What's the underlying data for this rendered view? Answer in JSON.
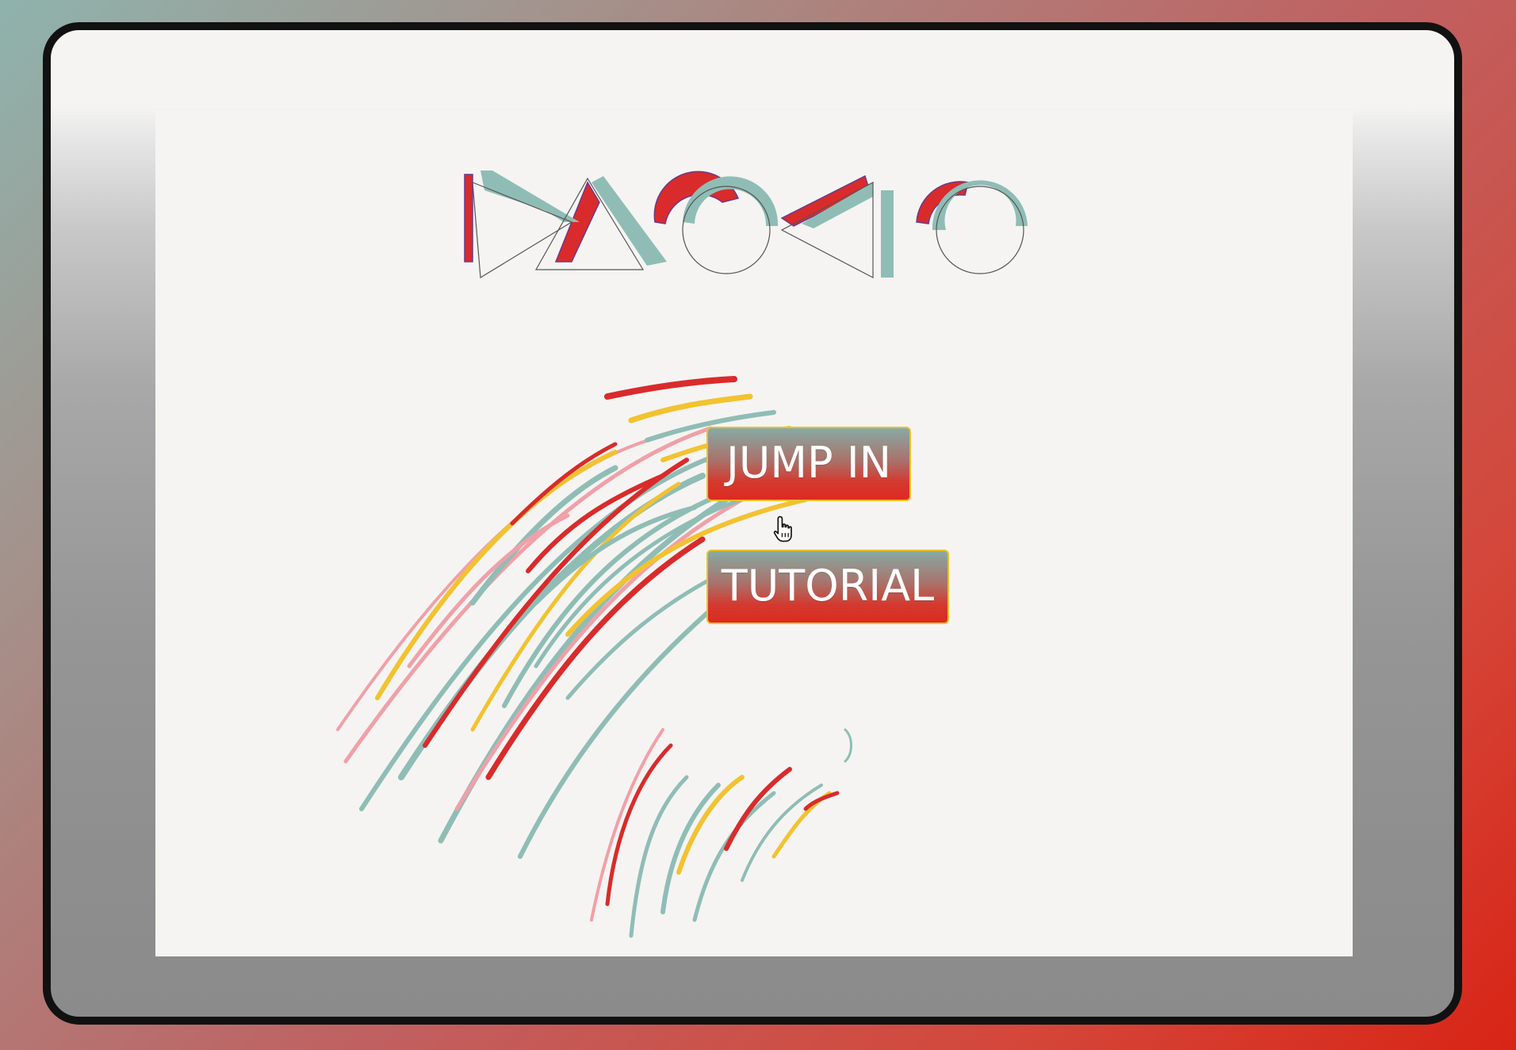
{
  "game": {
    "logo_alt": "DAOKO",
    "buttons": {
      "jump_in": "JUMP IN",
      "tutorial": "TUTORIAL"
    },
    "colors": {
      "teal": "#8fbdb6",
      "red": "#d92b2b",
      "yellow": "#f2c230",
      "pink": "#f0a0a8",
      "background": "#f5f4f2",
      "button_border": "#e9c22a"
    },
    "icons": {
      "cursor": "hand-pointer-icon"
    }
  }
}
